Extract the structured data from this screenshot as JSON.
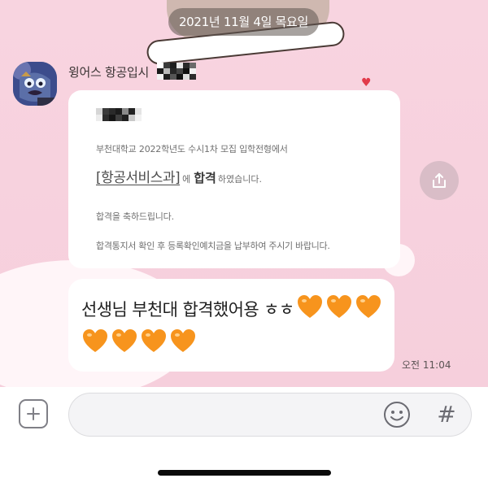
{
  "chat": {
    "date_divider": "2021년 11월 4일 목요일",
    "sender": {
      "name": "윙어스 항공입시"
    },
    "result_card": {
      "line1": "부천대학교 2022학년도 수시1차 모집 입학전형에서",
      "dept_name": "[항공서비스과]",
      "dept_suffix": "에",
      "pass_word": "합격",
      "pass_tail": "하였습니다.",
      "line3": "합격을 축하드립니다.",
      "line4": "합격통지서 확인 후 등록확인예치금을 납부하여 주시기 바랍니다."
    },
    "message": {
      "text": "선생님 부천대 합격했어용 ㅎㅎ",
      "heart_color": "#f7941d"
    },
    "timestamp": "오전 11:04"
  },
  "input_bar": {
    "attach_icon": "plus-icon",
    "emoji_icon": "emoji-icon",
    "hash_label": "#"
  },
  "colors": {
    "chat_background": "#f6cfdc",
    "bubble": "#ffffff",
    "date_pill": "#6e625e"
  }
}
